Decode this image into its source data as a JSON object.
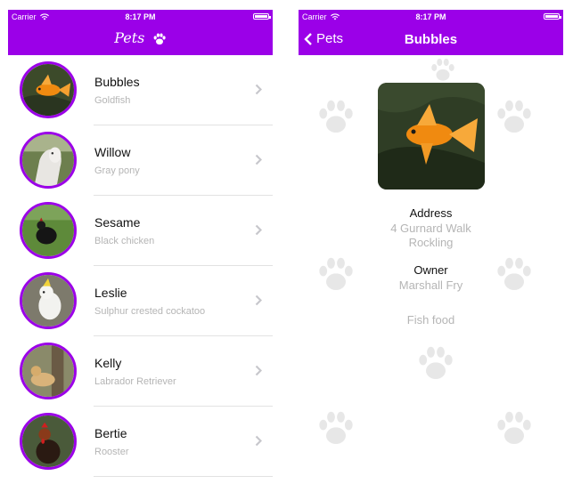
{
  "status_bar": {
    "carrier": "Carrier",
    "time": "8:17 PM"
  },
  "list_screen": {
    "title": "Pets",
    "pets": [
      {
        "name": "Bubbles",
        "subtitle": "Goldfish"
      },
      {
        "name": "Willow",
        "subtitle": "Gray pony"
      },
      {
        "name": "Sesame",
        "subtitle": "Black chicken"
      },
      {
        "name": "Leslie",
        "subtitle": "Sulphur crested cockatoo"
      },
      {
        "name": "Kelly",
        "subtitle": "Labrador Retriever"
      },
      {
        "name": "Bertie",
        "subtitle": "Rooster"
      }
    ]
  },
  "detail_screen": {
    "back_label": "Pets",
    "title": "Bubbles",
    "address_label": "Address",
    "address_line1": "4 Gurnard Walk",
    "address_line2": "Rockling",
    "owner_label": "Owner",
    "owner_name": "Marshall Fry",
    "food": "Fish food"
  },
  "colors": {
    "accent": "#9b00e8",
    "secondary_text": "#b5b5b5"
  },
  "icons": [
    "wifi-icon",
    "battery-icon",
    "paw-icon",
    "chevron-right-icon",
    "chevron-left-icon"
  ]
}
